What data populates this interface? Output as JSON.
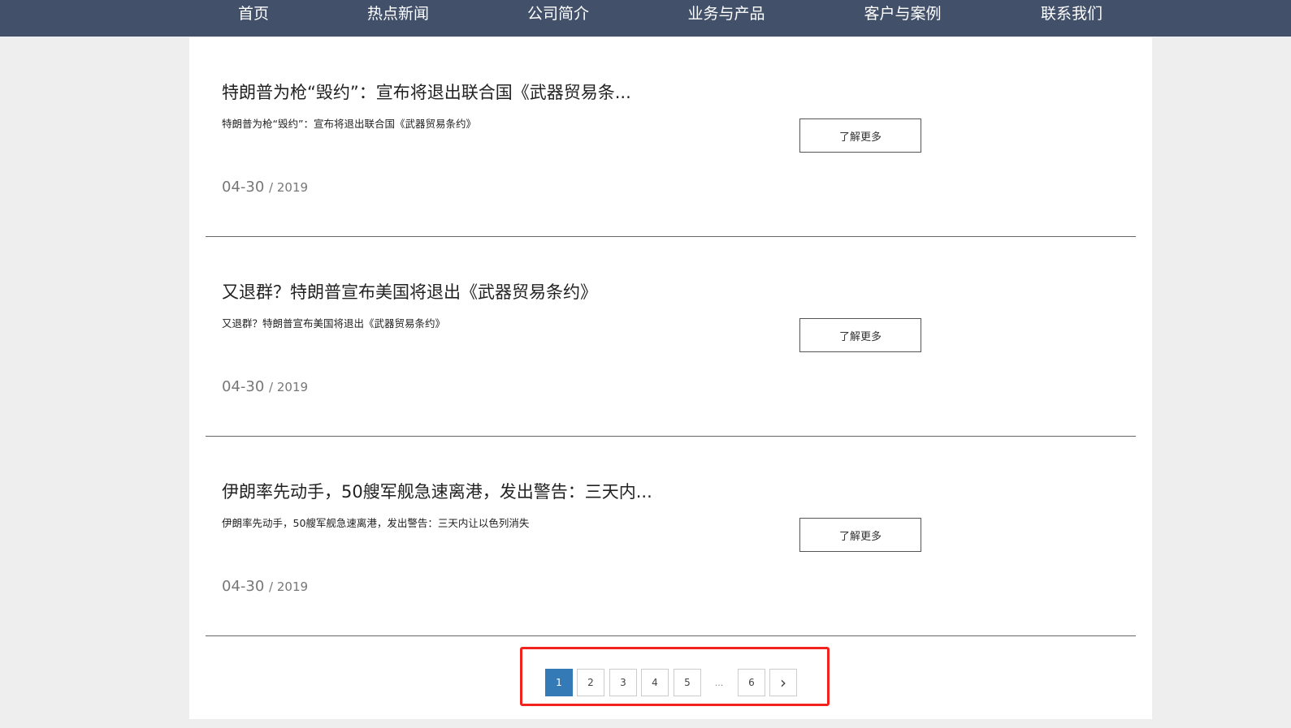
{
  "nav": [
    "首页",
    "热点新闻",
    "公司简介",
    "业务与产品",
    "客户与案例",
    "联系我们"
  ],
  "articles": [
    {
      "title": "特朗普为枪“毁约”：宣布将退出联合国《武器贸易条...",
      "summary": "特朗普为枪“毁约”：宣布将退出联合国《武器贸易条约》",
      "date": "04-30",
      "year": "/ 2019",
      "button": "了解更多"
    },
    {
      "title": "又退群？特朗普宣布美国将退出《武器贸易条约》",
      "summary": "又退群？特朗普宣布美国将退出《武器贸易条约》",
      "date": "04-30",
      "year": "/ 2019",
      "button": "了解更多"
    },
    {
      "title": "伊朗率先动手，50艘军舰急速离港，发出警告：三天内...",
      "summary": "伊朗率先动手，50艘军舰急速离港，发出警告：三天内让以色列消失",
      "date": "04-30",
      "year": "/ 2019",
      "button": "了解更多"
    }
  ],
  "pagination": {
    "pages": [
      "1",
      "2",
      "3",
      "4",
      "5"
    ],
    "ellipsis": "...",
    "last": "6",
    "next": "›",
    "current": "1"
  }
}
